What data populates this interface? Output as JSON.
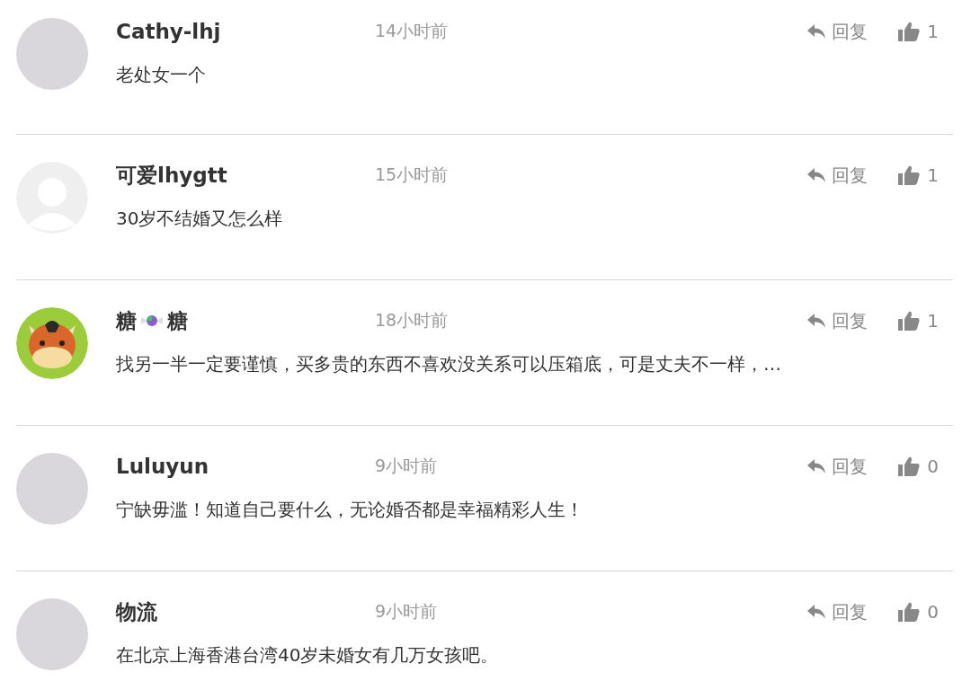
{
  "comments": [
    {
      "kind": "photo",
      "name": [
        "Cathy-lhj"
      ],
      "time": "14小时前",
      "text": "老处女一个",
      "reply": "回复",
      "likes": "1"
    },
    {
      "kind": "default",
      "name": [
        "可爱lhygtt"
      ],
      "time": "15小时前",
      "text": "30岁不结婚又怎么样",
      "reply": "回复",
      "likes": "1"
    },
    {
      "kind": "horse",
      "name": [
        "糖",
        "糖"
      ],
      "time": "18小时前",
      "text": "找另一半一定要谨慎，买多贵的东西不喜欢没关系可以压箱底，可是丈夫不一样，…",
      "reply": "回复",
      "likes": "1"
    },
    {
      "kind": "photo",
      "name": [
        "Luluyun"
      ],
      "time": "9小时前",
      "text": "宁缺毋滥！知道自己要什么，无论婚否都是幸福精彩人生！",
      "reply": "回复",
      "likes": "0"
    },
    {
      "kind": "photo",
      "name": [
        "物流"
      ],
      "time": "9小时前",
      "text": "在北京上海香港台湾40岁未婚女有几万女孩吧。",
      "reply": "回复",
      "likes": "0"
    }
  ]
}
